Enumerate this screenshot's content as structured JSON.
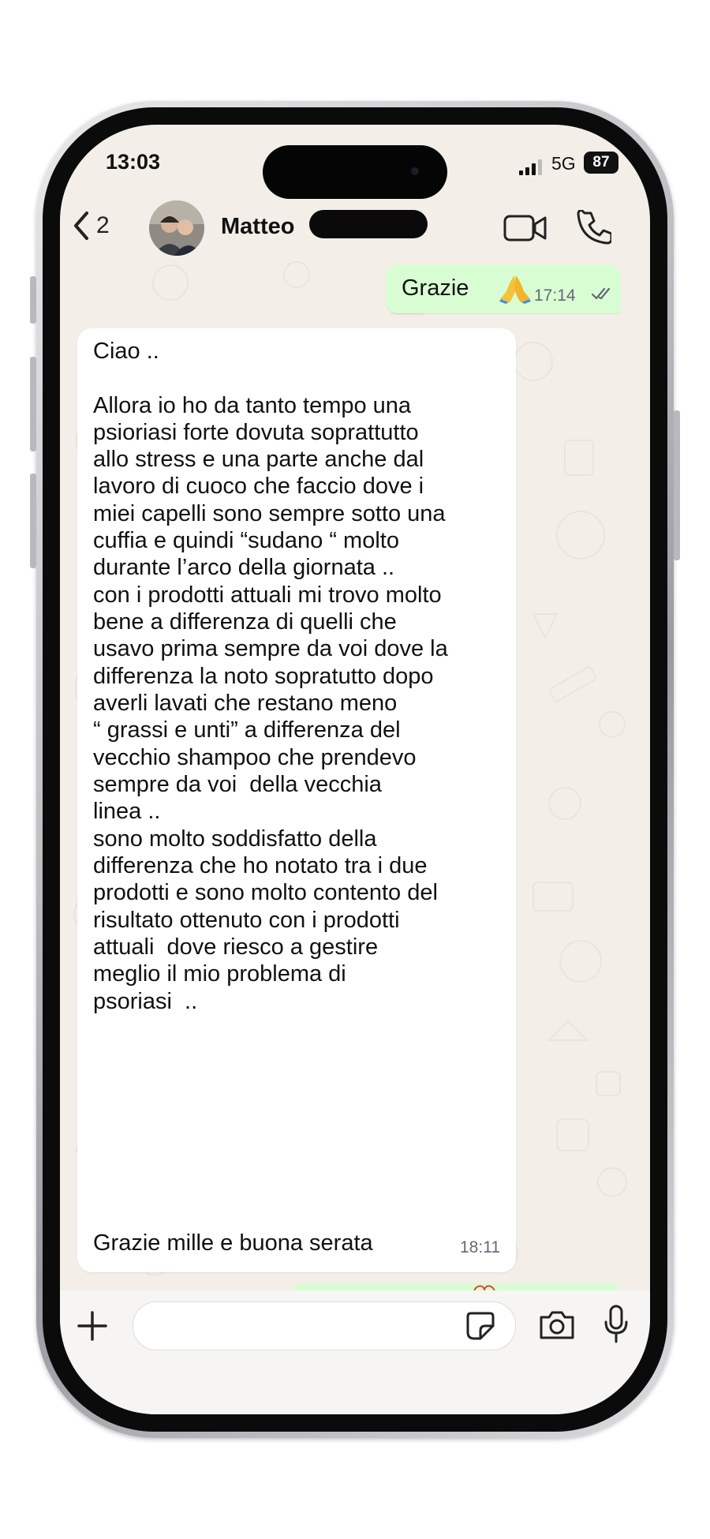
{
  "status_bar": {
    "time": "13:03",
    "network": "5G",
    "battery": "87"
  },
  "header": {
    "back_count": "2",
    "contact_name": "Matteo"
  },
  "messages": {
    "outgoing_1": {
      "text": "Grazie",
      "time": "17:14"
    },
    "incoming_1": {
      "lines": [
        "Ciao ..",
        "",
        "Allora io ho da tanto tempo una",
        "psioriasi forte dovuta soprattutto",
        "allo stress e una parte anche dal",
        "lavoro di cuoco che faccio dove i",
        "miei capelli sono sempre sotto una",
        "cuffia e quindi “sudano “ molto",
        "durante l’arco della giornata ..",
        "con i prodotti attuali mi trovo molto",
        "bene a differenza di quelli che",
        "usavo prima sempre da voi dove la",
        "differenza la noto sopratutto dopo",
        "averli lavati che restano meno",
        "“ grassi e unti” a differenza del",
        "vecchio shampoo che prendevo",
        "sempre da voi  della vecchia",
        "linea ..",
        "sono molto soddisfatto della",
        "differenza che ho notato tra i due",
        "prodotti e sono molto contento del",
        "risultato ottenuto con i prodotti",
        "attuali  dove riesco a gestire",
        "meglio il mio problema di",
        "psoriasi  ..",
        "",
        "Grazie mille e buona serata"
      ],
      "time": "18:11"
    }
  },
  "icons": {
    "back": "chevron-left-icon",
    "video": "video-call-icon",
    "call": "phone-icon",
    "plus": "plus-icon",
    "sticker": "sticker-icon",
    "camera": "camera-icon",
    "mic": "microphone-icon",
    "ticks": "double-check-icon",
    "emoji": "folded-hands-emoji"
  },
  "colors": {
    "chat_background": "#f3efe8",
    "outgoing_bubble": "#d9fdd3",
    "incoming_bubble": "#ffffff"
  }
}
